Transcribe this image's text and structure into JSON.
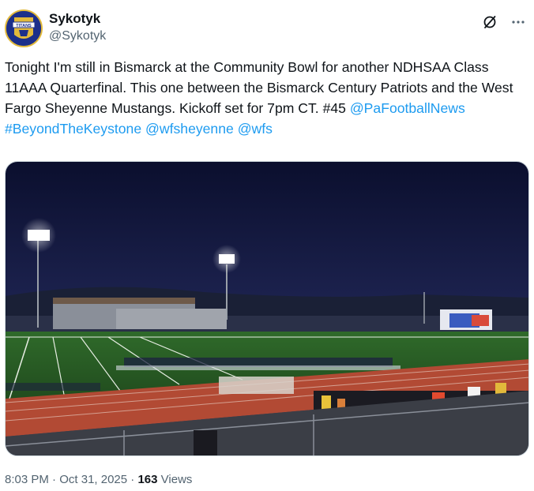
{
  "author": {
    "display_name": "Sykotyk",
    "handle": "@Sykotyk",
    "avatar_icon": "team-logo-avatar"
  },
  "actions": {
    "grok_icon": "slash-circle-icon",
    "more_icon": "more-dots-icon"
  },
  "tweet": {
    "text_main": "Tonight I'm still in Bismarck at the Community Bowl for another NDHSAA Class 11AAA Quarterfinal. This one between the Bismarck Century Patriots and the West Fargo Sheyenne Mustangs. Kickoff set for 7pm CT. #45 ",
    "links": [
      "@PaFootballNews",
      "#BeyondTheKeystone",
      "@wfsheyenne",
      "@wfs"
    ]
  },
  "media": {
    "description_icon": "stadium-photo"
  },
  "meta": {
    "time": "8:03 PM",
    "separator": " · ",
    "date": "Oct 31, 2025",
    "views_count": "163",
    "views_label": " Views"
  },
  "colors": {
    "link": "#1d9bf0",
    "secondary_text": "#536471",
    "primary_text": "#0f1419"
  }
}
